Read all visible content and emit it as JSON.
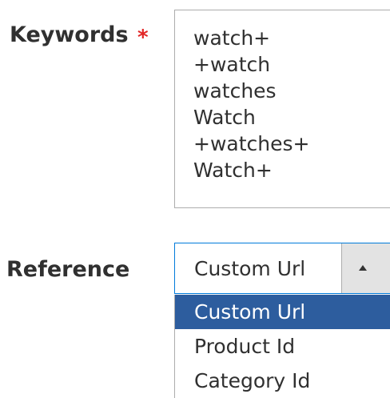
{
  "keywords": {
    "label": "Keywords",
    "required_marker": "*",
    "value": "watch+\n+watch\nwatches\nWatch\n+watches+\nWatch+"
  },
  "reference": {
    "label": "Reference",
    "selected_value": "Custom Url",
    "toggle_icon": "chevron-up-icon",
    "options": [
      {
        "label": "Custom Url",
        "selected": true
      },
      {
        "label": "Product Id",
        "selected": false
      },
      {
        "label": "Category Id",
        "selected": false
      }
    ]
  },
  "colors": {
    "required": "#e22626",
    "focus_border": "#007bdb",
    "option_highlight": "#2d5d9e"
  }
}
